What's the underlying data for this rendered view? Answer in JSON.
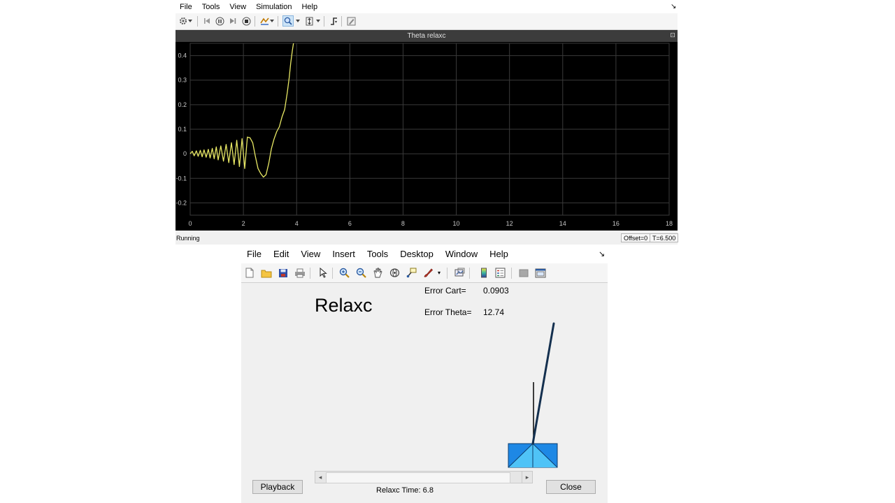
{
  "scope": {
    "menu": [
      "File",
      "Tools",
      "View",
      "Simulation",
      "Help"
    ],
    "dock_glyph": "↘",
    "toolbar_icons": [
      "gear-icon",
      "dropdown-icon",
      "step-back-icon",
      "pause-icon",
      "step-forward-icon",
      "stop-icon",
      "highlight-icon",
      "dropdown-icon",
      "zoom-icon",
      "dropdown-icon",
      "autoscale-icon",
      "dropdown-icon",
      "trigger-icon",
      "edit-icon"
    ],
    "plot_title": "Theta relaxc",
    "status_text": "Running",
    "offset_text": "Offset=0",
    "time_text": "T=6.500",
    "undock_glyph": "⊡",
    "colors": {
      "background": "#000000",
      "grid": "#3a3a3a",
      "trace": "#e8e864",
      "axis_text": "#c8c8c8"
    }
  },
  "chart_data": {
    "type": "line",
    "title": "Theta relaxc",
    "xlim": [
      0,
      18
    ],
    "ylim": [
      -0.25,
      0.45
    ],
    "x_ticks": [
      0,
      2,
      4,
      6,
      8,
      10,
      12,
      14,
      16,
      18
    ],
    "y_ticks": [
      0.4,
      0.3,
      0.2,
      0.1,
      0,
      -0.1,
      -0.2
    ],
    "x_tick_labels": [
      "0",
      "2",
      "4",
      "6",
      "8",
      "10",
      "12",
      "14",
      "16",
      "18"
    ],
    "y_tick_labels": [
      "0.4",
      "0.3",
      "0.2",
      "0.1",
      "0",
      "-0.1",
      "-0.2"
    ],
    "grid": true,
    "series": [
      {
        "color": "#e8e864",
        "x": [
          0,
          0.08,
          0.15,
          0.23,
          0.3,
          0.38,
          0.45,
          0.52,
          0.6,
          0.68,
          0.75,
          0.83,
          0.9,
          0.98,
          1.05,
          1.15,
          1.25,
          1.35,
          1.45,
          1.55,
          1.65,
          1.75,
          1.85,
          1.95,
          2.05,
          2.15,
          2.25,
          2.35,
          2.45,
          2.55,
          2.65,
          2.75,
          2.85,
          2.95,
          3.05,
          3.15,
          3.25,
          3.35,
          3.45,
          3.55,
          3.65,
          3.72,
          3.78,
          3.84,
          3.88
        ],
        "y": [
          0,
          0.01,
          -0.008,
          0.012,
          -0.01,
          0.014,
          -0.012,
          0.016,
          -0.014,
          0.018,
          -0.017,
          0.022,
          -0.02,
          0.028,
          -0.025,
          0.032,
          -0.03,
          0.038,
          -0.036,
          0.045,
          -0.044,
          0.055,
          -0.052,
          0.062,
          -0.06,
          0.068,
          0.065,
          0.045,
          -0.01,
          -0.06,
          -0.08,
          -0.095,
          -0.085,
          -0.04,
          0.02,
          0.06,
          0.09,
          0.11,
          0.15,
          0.18,
          0.25,
          0.31,
          0.37,
          0.42,
          0.45
        ]
      }
    ]
  },
  "figure": {
    "menu": [
      "File",
      "Edit",
      "View",
      "Insert",
      "Tools",
      "Desktop",
      "Window",
      "Help"
    ],
    "dock_glyph": "↘",
    "title": "Relaxc",
    "error_cart_label": "Error Cart=",
    "error_cart_value": "0.0903",
    "error_theta_label": "Error Theta=",
    "error_theta_value": "12.74",
    "time_label": "Relaxc Time:",
    "time_value": "6.8",
    "playback_label": "Playback",
    "close_label": "Close",
    "slider_left_glyph": "◂",
    "slider_right_glyph": "▸",
    "toolbar_glyphs": {
      "new": "🗋",
      "open": "📂",
      "save": "💾",
      "print": "🖶",
      "pointer": "↖",
      "zoom_in": "🔍",
      "zoom_out": "🔎",
      "pan": "✋",
      "rotate": "⟳",
      "data_cursor": "⌖",
      "brush": "🖌",
      "brush_menu": "▾",
      "link": "⧉",
      "colorbar": "▮",
      "legend": "☷",
      "hide_tools": "▤",
      "dock": "▣"
    },
    "colors": {
      "cart_dark": "#1e88e5",
      "cart_light": "#4fc3f7",
      "pole": "#14304f",
      "reference": "#000000"
    }
  }
}
